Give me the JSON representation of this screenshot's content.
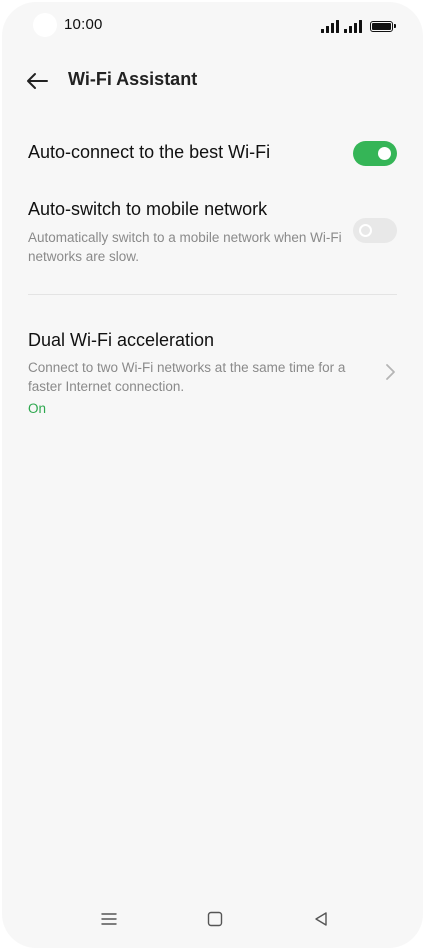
{
  "status_bar": {
    "time": "10:00",
    "icons": [
      "signal-icon",
      "signal-icon",
      "battery-icon"
    ]
  },
  "header": {
    "back_icon": "arrow-left-icon",
    "title": "Wi-Fi Assistant"
  },
  "settings": {
    "auto_connect": {
      "title": "Auto-connect to the best Wi-Fi",
      "enabled": true
    },
    "auto_switch": {
      "title": "Auto-switch to mobile network",
      "description": "Automatically switch to a mobile network when Wi-Fi networks are slow.",
      "enabled": false
    },
    "dual_wifi": {
      "title": "Dual Wi-Fi acceleration",
      "description": "Connect to two Wi-Fi networks at the same time for a faster Internet connection.",
      "status": "On",
      "icon": "chevron-right-icon"
    }
  },
  "nav_bar": {
    "icons": [
      "menu-icon",
      "home-square-icon",
      "back-triangle-icon"
    ]
  },
  "colors": {
    "accent": "#35b557",
    "status_on": "#2ea84f",
    "background": "#f7f7f7",
    "toggle_off": "#e8e8e8"
  }
}
